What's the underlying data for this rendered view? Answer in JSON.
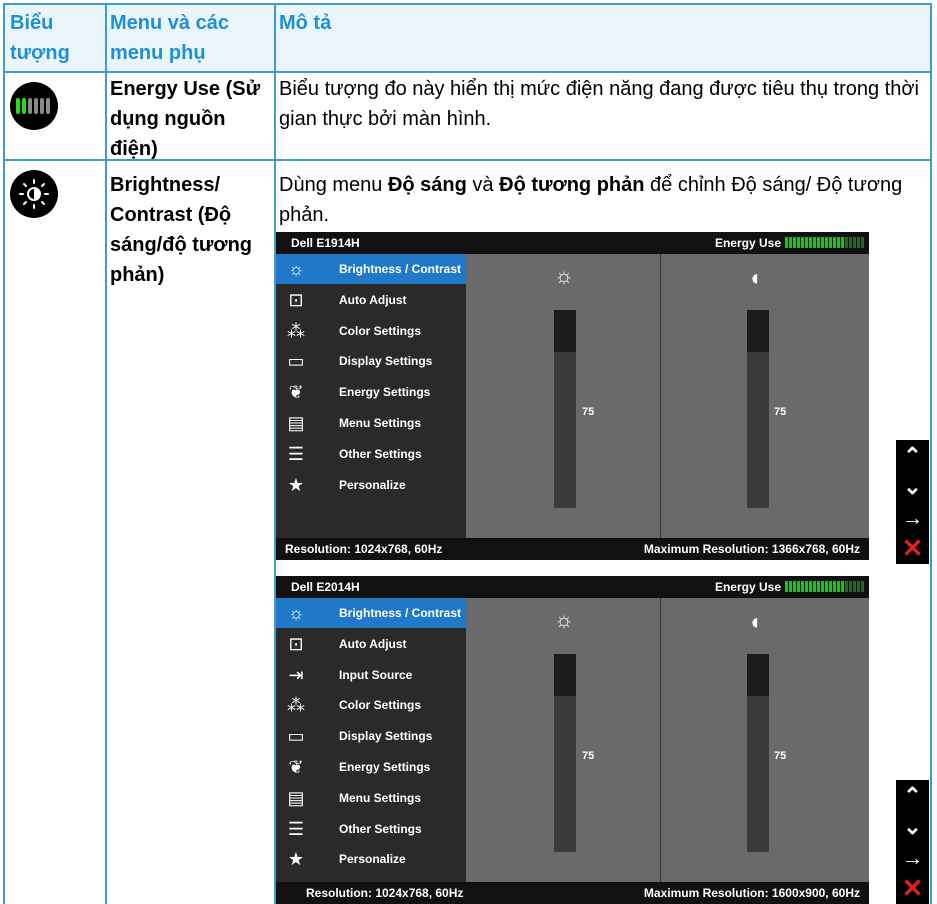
{
  "table": {
    "headers": [
      "Biểu tượng",
      "Menu và các menu phụ",
      "Mô tả"
    ],
    "rows": [
      {
        "icon": "energy-meter-icon",
        "menu": "Energy Use (Sử dụng nguồn điện)",
        "description": "Biểu tượng đo này hiển thị mức điện năng đang được tiêu thụ trong thời gian thực bởi màn hình."
      },
      {
        "icon": "brightness-contrast-icon",
        "menu": "Brightness/ Contrast (Độ sáng/độ tương phản)",
        "description_parts": [
          "Dùng menu ",
          "Độ sáng",
          " và ",
          "Độ tương phản",
          " để chỉnh Độ sáng/ Độ tương phản."
        ]
      }
    ]
  },
  "osd1": {
    "model": "Dell E1914H",
    "energy_label": "Energy Use",
    "energy_level": 0.75,
    "menu": [
      "Brightness / Contrast",
      "Auto Adjust",
      "Color Settings",
      "Display Settings",
      "Energy Settings",
      "Menu Settings",
      "Other Settings",
      "Personalize"
    ],
    "menu_icons": [
      "sun-icon",
      "auto-adjust-icon",
      "color-dots-icon",
      "display-icon",
      "leaf-icon",
      "menu-icon",
      "sliders-icon",
      "star-icon"
    ],
    "brightness_value": "75",
    "contrast_value": "75",
    "resolution": "Resolution: 1024x768, 60Hz",
    "max_resolution": "Maximum Resolution: 1366x768, 60Hz"
  },
  "osd2": {
    "model": "Dell E2014H",
    "energy_label": "Energy Use",
    "energy_level": 0.75,
    "menu": [
      "Brightness / Contrast",
      "Auto Adjust",
      "Input Source",
      "Color Settings",
      "Display Settings",
      "Energy Settings",
      "Menu Settings",
      "Other Settings",
      "Personalize"
    ],
    "menu_icons": [
      "sun-icon",
      "auto-adjust-icon",
      "input-source-icon",
      "color-dots-icon",
      "display-icon",
      "leaf-icon",
      "menu-icon",
      "sliders-icon",
      "star-icon"
    ],
    "brightness_value": "75",
    "contrast_value": "75",
    "resolution": "Resolution: 1024x768, 60Hz",
    "max_resolution": "Maximum Resolution: 1600x900, 60Hz"
  },
  "nav_buttons": [
    "up-arrow-icon",
    "down-arrow-icon",
    "right-arrow-icon",
    "close-icon"
  ],
  "colors": {
    "header_text": "#1e90d6",
    "grid": "#3d9bd1",
    "osd_selected": "#1f78c8",
    "meter_green": "#27b827"
  }
}
